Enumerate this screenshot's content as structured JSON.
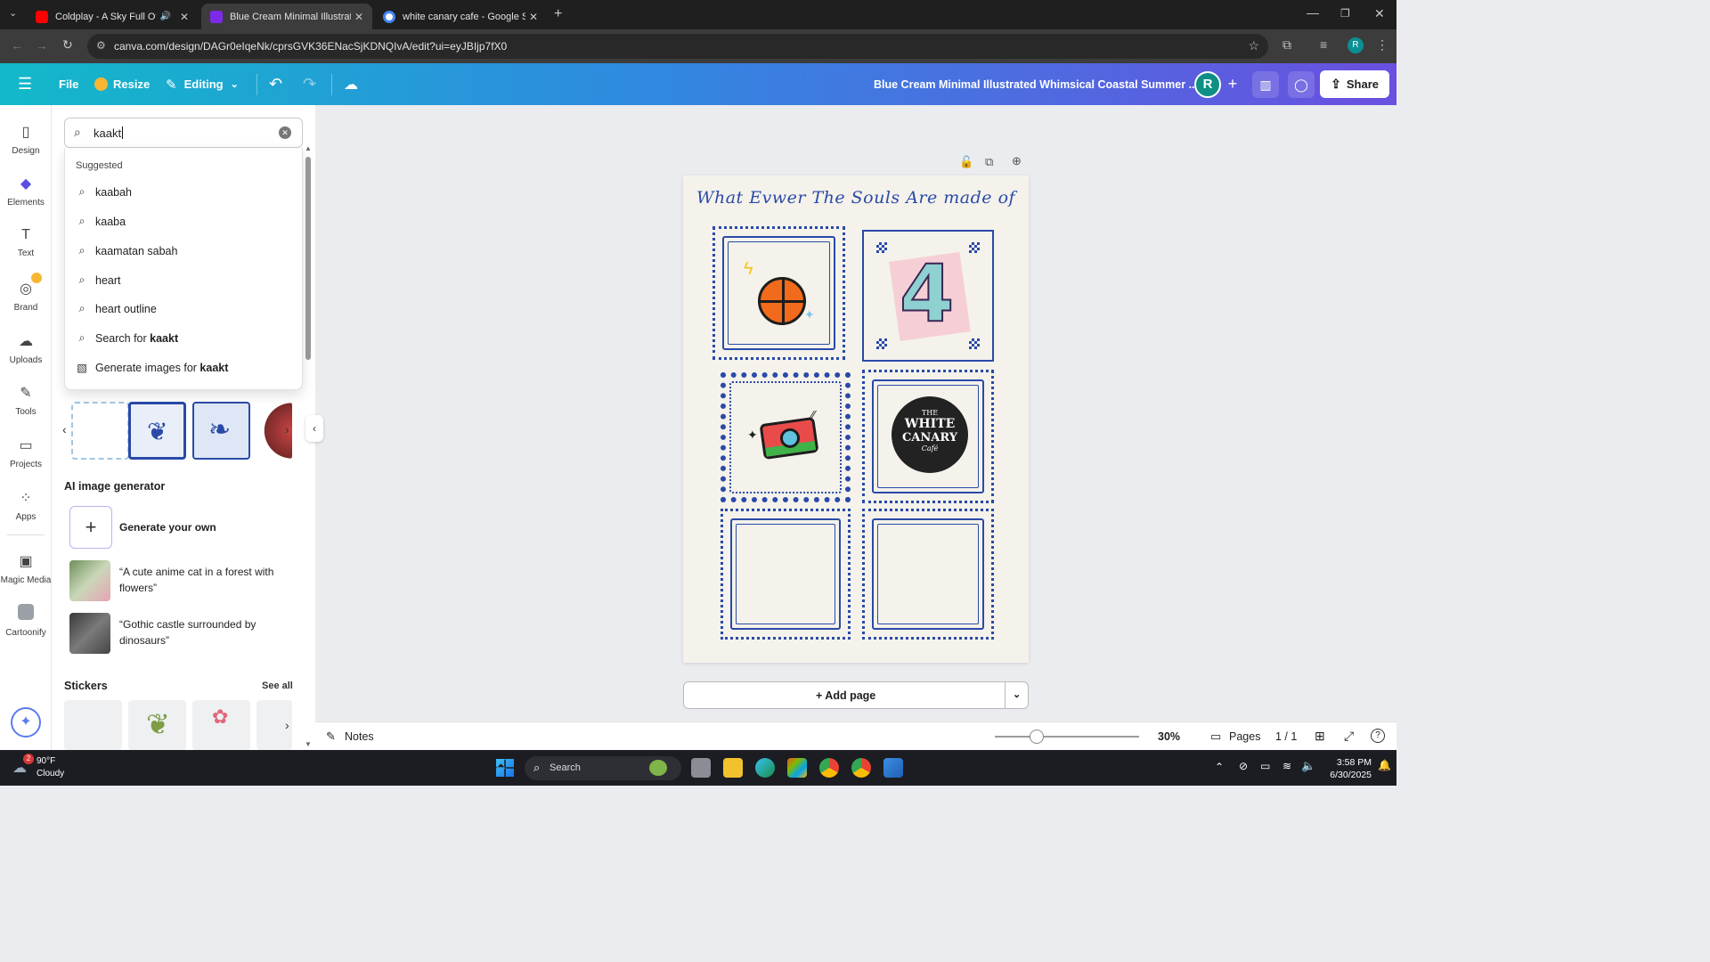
{
  "browser": {
    "tabs": [
      {
        "title": "Coldplay - A Sky Full Of Sta",
        "favicon_color": "#ff0000"
      },
      {
        "title": "Blue Cream Minimal Illustrated",
        "favicon_color": "#7d2ae8"
      },
      {
        "title": "white canary cafe - Google Sea",
        "favicon_color": "#4285f4"
      }
    ],
    "url": "canva.com/design/DAGr0eIqeNk/cprsGVK36ENacSjKDNQIvA/edit?ui=eyJBIjp7fX0",
    "profile_initial": "R"
  },
  "header": {
    "file_label": "File",
    "resize_label": "Resize",
    "editing_label": "Editing",
    "design_title": "Blue Cream Minimal Illustrated Whimsical Coastal Summer ...",
    "avatar_initial": "R",
    "share_label": "Share"
  },
  "rail": {
    "items": [
      {
        "label": "Design",
        "icon": "layout-icon"
      },
      {
        "label": "Elements",
        "icon": "shapes-icon"
      },
      {
        "label": "Text",
        "icon": "text-icon"
      },
      {
        "label": "Brand",
        "icon": "brand-icon"
      },
      {
        "label": "Uploads",
        "icon": "cloud-upload-icon"
      },
      {
        "label": "Tools",
        "icon": "pen-icon"
      },
      {
        "label": "Projects",
        "icon": "folder-icon"
      },
      {
        "label": "Apps",
        "icon": "apps-icon"
      },
      {
        "label": "Magic Media",
        "icon": "magic-media-icon"
      },
      {
        "label": "Cartoonify",
        "icon": "cartoonify-icon"
      }
    ]
  },
  "panel": {
    "search_value": "kaakt",
    "suggested_heading": "Suggested",
    "suggestions": [
      "kaabah",
      "kaaba",
      "kaamatan sabah",
      "heart",
      "heart outline"
    ],
    "search_for_prefix": "Search for ",
    "search_for_term": "kaakt",
    "generate_prefix": "Generate images for ",
    "generate_term": "kaakt",
    "ai_heading": "AI image generator",
    "generate_own": "Generate your own",
    "prompts": [
      "“A cute anime cat in a forest with flowers”",
      "“Gothic castle surrounded by dinosaurs”"
    ],
    "stickers_heading": "Stickers",
    "see_all": "See all"
  },
  "canvas": {
    "title": "What Evwer The Souls Are made of",
    "logo_line1": "THE",
    "logo_line2": "WHITE",
    "logo_line3": "CANARY",
    "logo_line4": "Café",
    "big_number": "4",
    "add_page": "+ Add page"
  },
  "bottom": {
    "notes": "Notes",
    "zoom": "30%",
    "pages_label": "Pages",
    "page_count": "1 / 1"
  },
  "taskbar": {
    "weather_temp": "90°F",
    "weather_desc": "Cloudy",
    "weather_badge": "2",
    "search_label": "Search",
    "time": "3:58 PM",
    "date": "6/30/2025"
  },
  "colors": {
    "accent_purple": "#7d2ae8",
    "tile_blue": "#2a4aa8",
    "header_start": "#12b9c9",
    "header_end": "#6a4fe0"
  }
}
